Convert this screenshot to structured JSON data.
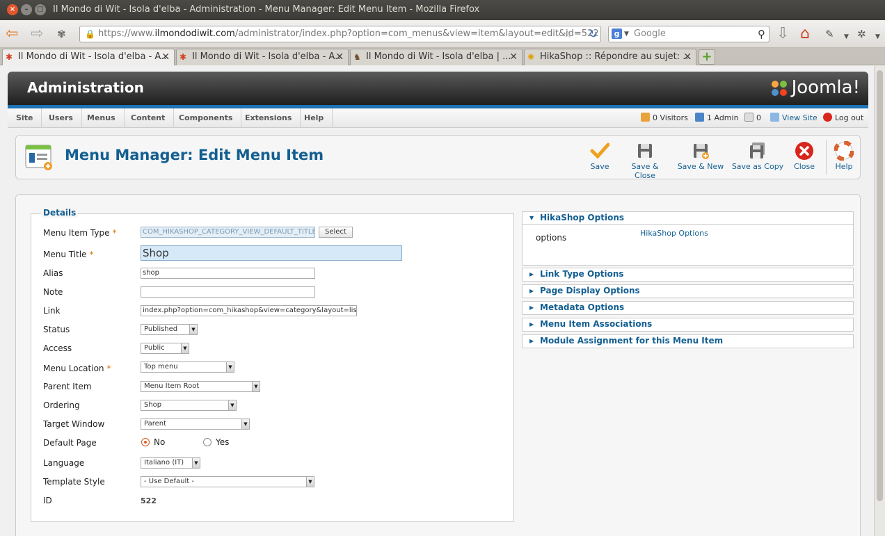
{
  "window": {
    "title": "Il Mondo di Wit - Isola d'elba - Administration - Menu Manager: Edit Menu Item - Mozilla Firefox"
  },
  "browser": {
    "url_prefix": "https://www.",
    "url_domain": "ilmondodiwit.com",
    "url_rest": "/administrator/index.php?option=com_menus&view=item&layout=edit&id=522",
    "search_placeholder": "Google",
    "tabs": [
      {
        "label": "Il Mondo di Wit - Isola d'elba - A..."
      },
      {
        "label": "Il Mondo di Wit - Isola d'elba - A..."
      },
      {
        "label": "Il Mondo di Wit - Isola d'elba | ..."
      },
      {
        "label": "HikaShop :: Répondre au sujet: ..."
      }
    ]
  },
  "header": {
    "title": "Administration",
    "logo_text": "Joomla!"
  },
  "menu": {
    "items": [
      "Site",
      "Users",
      "Menus",
      "Content",
      "Components",
      "Extensions",
      "Help"
    ]
  },
  "status": {
    "visitors": "0 Visitors",
    "admins": "1 Admin",
    "messages": "0",
    "view_site": "View Site",
    "logout": "Log out"
  },
  "toolbar": {
    "page_title": "Menu Manager: Edit Menu Item",
    "save": "Save",
    "save_close": "Save & Close",
    "save_new": "Save & New",
    "save_copy": "Save as Copy",
    "close": "Close",
    "help": "Help"
  },
  "details": {
    "legend": "Details",
    "menu_item_type_label": "Menu Item Type",
    "menu_item_type_value": "COM_HIKASHOP_CATEGORY_VIEW_DEFAULT_TITLE",
    "select_button": "Select",
    "menu_title_label": "Menu Title",
    "menu_title_value": "Shop",
    "alias_label": "Alias",
    "alias_value": "shop",
    "note_label": "Note",
    "note_value": "",
    "link_label": "Link",
    "link_value": "index.php?option=com_hikashop&view=category&layout=listing",
    "status_label": "Status",
    "status_value": "Published",
    "access_label": "Access",
    "access_value": "Public",
    "menu_location_label": "Menu Location",
    "menu_location_value": "Top menu",
    "parent_item_label": "Parent Item",
    "parent_item_value": "Menu Item Root",
    "ordering_label": "Ordering",
    "ordering_value": "Shop",
    "target_window_label": "Target Window",
    "target_window_value": "Parent",
    "default_page_label": "Default Page",
    "default_page_no": "No",
    "default_page_yes": "Yes",
    "language_label": "Language",
    "language_value": "Italiano (IT)",
    "template_style_label": "Template Style",
    "template_style_value": "- Use Default -",
    "id_label": "ID",
    "id_value": "522",
    "required_mark": "*"
  },
  "accordion": {
    "hikashop": {
      "title": "HikaShop Options",
      "options_label": "options",
      "options_link": "HikaShop Options"
    },
    "link_type": "Link Type Options",
    "page_display": "Page Display Options",
    "metadata": "Metadata Options",
    "associations": "Menu Item Associations",
    "module_assignment": "Module Assignment for this Menu Item"
  },
  "colors": {
    "joomla_blue": "#135f91",
    "accent_bar": "#1e73b5",
    "required": "#e07000"
  }
}
